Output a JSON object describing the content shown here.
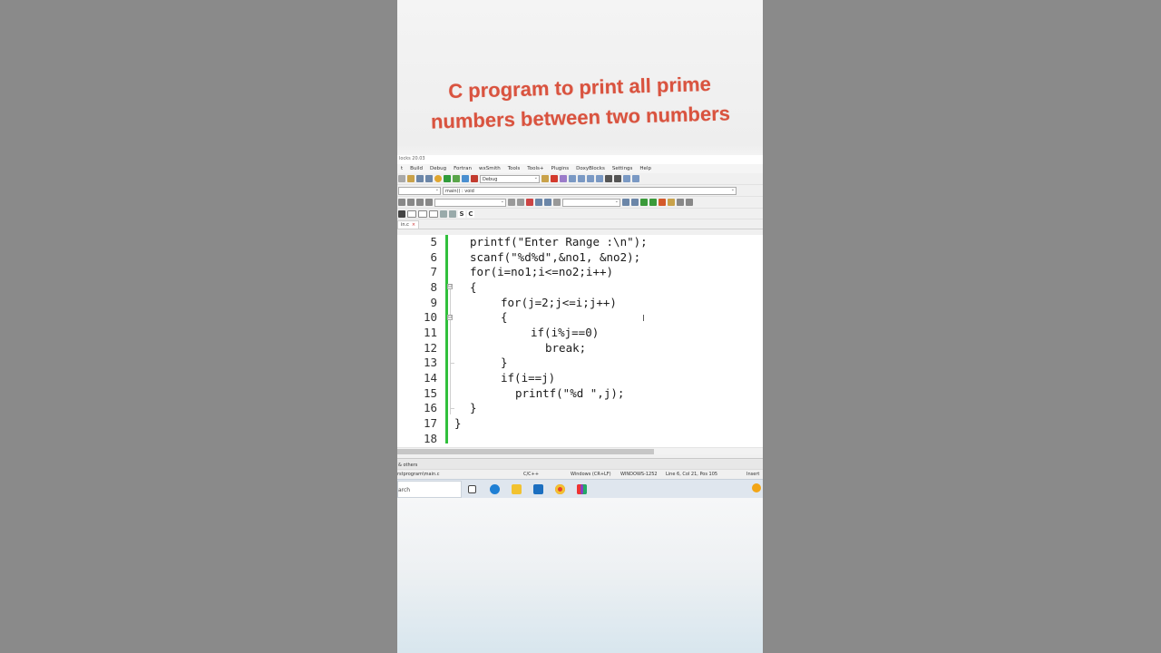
{
  "title": {
    "line1": "C program to print all prime",
    "line2": "numbers between two numbers"
  },
  "window": {
    "title": "locks 20.03"
  },
  "menu": [
    "t",
    "Build",
    "Debug",
    "Fortran",
    "wxSmith",
    "Tools",
    "Tools+",
    "Plugins",
    "DoxyBlocks",
    "Settings",
    "Help"
  ],
  "toolbar": {
    "build_target": "Debug",
    "scope": "",
    "function": "main() : void",
    "search_value": "",
    "search2_value": ""
  },
  "tab": {
    "label": "in.c",
    "close": "×"
  },
  "editor": {
    "lines": [
      {
        "num": "5",
        "text": "printf(\"Enter Range :\\n\");"
      },
      {
        "num": "6",
        "text": "scanf(\"%d%d\",&no1, &no2);"
      },
      {
        "num": "7",
        "text": "for(i=no1;i<=no2;i++)"
      },
      {
        "num": "8",
        "text": "{"
      },
      {
        "num": "9",
        "text": "for(j=2;j<=i;j++)"
      },
      {
        "num": "10",
        "text": "{"
      },
      {
        "num": "11",
        "text": "if(i%j==0)"
      },
      {
        "num": "12",
        "text": "break;"
      },
      {
        "num": "13",
        "text": "}"
      },
      {
        "num": "14",
        "text": "if(i==j)"
      },
      {
        "num": "15",
        "text": "printf(\"%d \",j);"
      },
      {
        "num": "16",
        "text": "}"
      },
      {
        "num": "17",
        "text": "}"
      },
      {
        "num": "18",
        "text": ""
      }
    ]
  },
  "logbar": {
    "label": "& others"
  },
  "status": {
    "path": "rstprogram\\main.c",
    "lang": "C/C++",
    "eol": "Windows (CR+LF)",
    "encoding": "WINDOWS-1252",
    "position": "Line 6, Col 21, Pos 105",
    "mode": "Insert"
  },
  "taskbar": {
    "search_placeholder": "arch"
  },
  "colors": {
    "title": "#d9533f",
    "gutter_change": "#31c03c",
    "keyword": "#00005a",
    "string": "#1b2bb8",
    "operator": "#d04020"
  }
}
